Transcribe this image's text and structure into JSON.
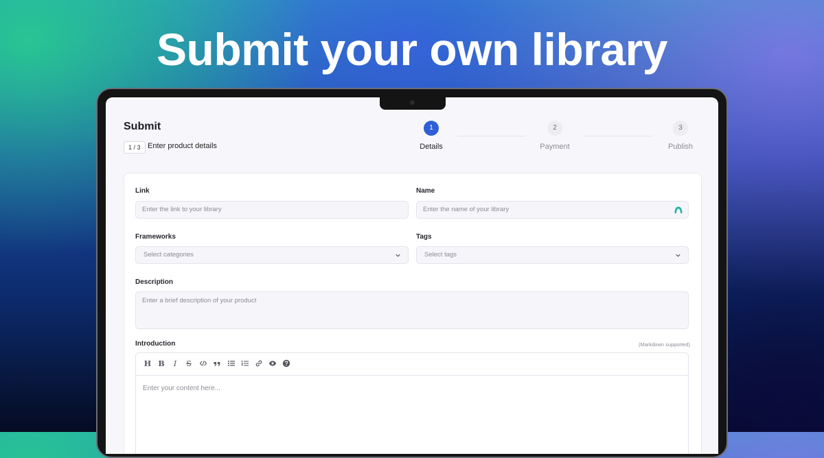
{
  "headline": "Submit your own library",
  "header": {
    "title": "Submit",
    "step_badge": "1 / 3",
    "step_caption": "Enter product details"
  },
  "stepper": {
    "steps": [
      {
        "number": "1",
        "label": "Details",
        "state": "active"
      },
      {
        "number": "2",
        "label": "Payment",
        "state": "idle"
      },
      {
        "number": "3",
        "label": "Publish",
        "state": "idle"
      }
    ]
  },
  "form": {
    "link": {
      "label": "Link",
      "placeholder": "Enter the link to your library"
    },
    "name": {
      "label": "Name",
      "placeholder": "Enter the name of your library"
    },
    "frameworks": {
      "label": "Frameworks",
      "placeholder": "Select categories"
    },
    "tags": {
      "label": "Tags",
      "placeholder": "Select tags"
    },
    "description": {
      "label": "Description",
      "placeholder": "Enter a brief description of your product"
    },
    "introduction": {
      "label": "Introduction",
      "hint": "(Markdown supported)",
      "placeholder": "Enter your content here...",
      "toolbar": [
        "heading-icon",
        "bold-icon",
        "italic-icon",
        "strikethrough-icon",
        "code-icon",
        "quote-icon",
        "bullet-list-icon",
        "numbered-list-icon",
        "link-icon",
        "preview-eye-icon",
        "help-icon"
      ]
    }
  },
  "colors": {
    "accent": "#2f5fd6",
    "logo_teal": "#1fb5a3"
  }
}
